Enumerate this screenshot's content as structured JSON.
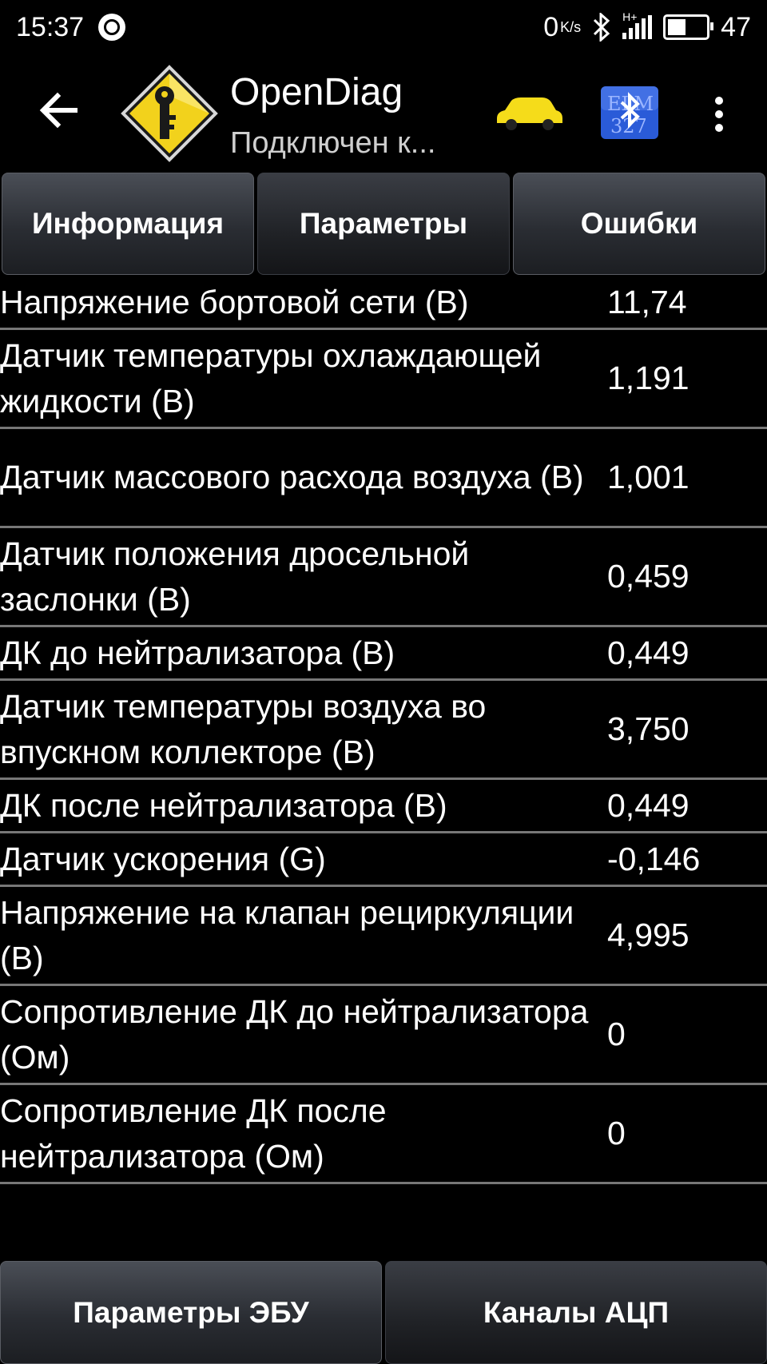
{
  "status_bar": {
    "time": "15:37",
    "net_speed_value": "0",
    "net_speed_unit": "K/s",
    "network_type": "H+",
    "battery_level": "47",
    "battery_fraction": 0.47
  },
  "action_bar": {
    "title": "OpenDiag",
    "subtitle": "Подключен к...",
    "elm_label": "ELM327"
  },
  "tabs": [
    {
      "label": "Информация",
      "active": false
    },
    {
      "label": "Параметры",
      "active": true
    },
    {
      "label": "Ошибки",
      "active": false
    }
  ],
  "parameters": [
    {
      "name": "Напряжение бортовой сети (В)",
      "value": "11,74"
    },
    {
      "name": "Датчик температуры охлаждающей жидкости (В)",
      "value": "1,191"
    },
    {
      "name": "Датчик массового расхода воздуха (В)",
      "value": "1,001"
    },
    {
      "name": "Датчик положения дросельной заслонки (В)",
      "value": "0,459"
    },
    {
      "name": "ДК до нейтрализатора (В)",
      "value": "0,449"
    },
    {
      "name": "Датчик температуры воздуха во впускном коллекторе (В)",
      "value": "3,750"
    },
    {
      "name": "ДК после нейтрализатора (В)",
      "value": "0,449"
    },
    {
      "name": "Датчик ускорения (G)",
      "value": "-0,146"
    },
    {
      "name": "Напряжение на клапан рециркуляции (В)",
      "value": "4,995"
    },
    {
      "name": "Сопротивление ДК до нейтрализатора (Ом)",
      "value": "0"
    },
    {
      "name": "Сопротивление ДК после нейтрализатора (Ом)",
      "value": "0"
    }
  ],
  "bottom_buttons": [
    {
      "label": "Параметры ЭБУ",
      "active": false
    },
    {
      "label": "Каналы АЦП",
      "active": true
    }
  ],
  "colors": {
    "background": "#000000",
    "logo_yellow": "#f2d21c",
    "car_yellow": "#f5dc1a",
    "elm_blue": "#2a5bd8",
    "divider": "#777777"
  }
}
